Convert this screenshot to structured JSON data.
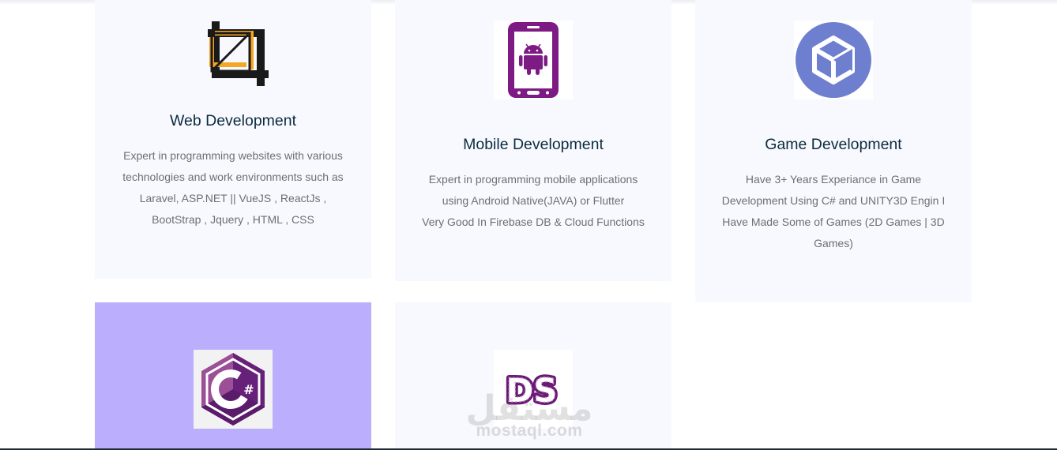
{
  "services": [
    {
      "title": "Web Development",
      "icon": "crop-icon",
      "lines": [
        "Expert in programming websites with various",
        "technologies and work environments such as",
        "Laravel, ASP.NET || VueJS , ReactJs ,",
        "BootStrap , Jquery , HTML , CSS"
      ]
    },
    {
      "title": "Mobile Development",
      "icon": "android-phone-icon",
      "lines": [
        "Expert in programming mobile applications",
        "using Android Native(JAVA) or Flutter",
        "Very Good In Firebase DB & Cloud Functions"
      ]
    },
    {
      "title": "Game Development",
      "icon": "unity-logo-icon",
      "lines": [
        "Have 3+ Years Experiance in Game",
        "Development Using C# and UNITY3D Engin I",
        "Have Made Some of Games (2D Games | 3D",
        "Games)"
      ]
    },
    {
      "icon": "csharp-logo-icon"
    },
    {
      "icon": "ds-logo-icon",
      "logo_text": "DS"
    }
  ],
  "watermark": {
    "arabic": "مستقل",
    "latin": "mostaql.com"
  },
  "colors": {
    "card_bg": "#f8f9fe",
    "card_highlight": "#bbaefc",
    "title": "#0b2b3f",
    "text": "#6b6f76",
    "crop_orange": "#f5a623",
    "android_purple": "#7e1a83",
    "unity_blue": "#6f7fcf",
    "csharp_purple": "#68217a"
  }
}
